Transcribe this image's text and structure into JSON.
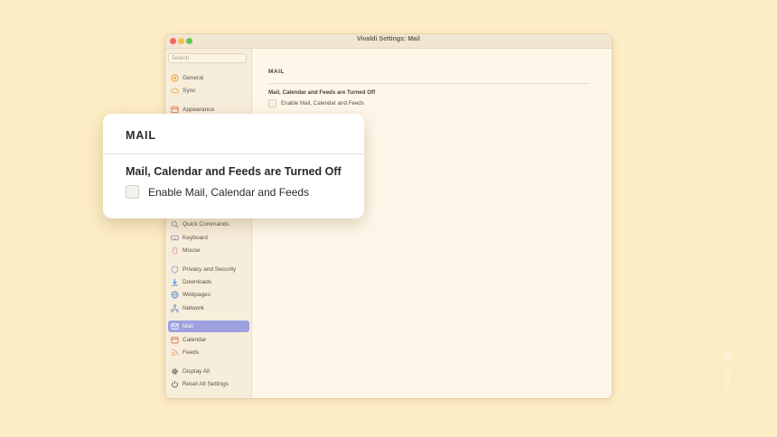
{
  "window": {
    "title": "Vivaldi Settings: Mail"
  },
  "sidebar": {
    "search_placeholder": "Search",
    "items": [
      {
        "label": "General",
        "icon": "general-icon",
        "color": "#f2a33a"
      },
      {
        "label": "Sync",
        "icon": "cloud-icon",
        "color": "#e8b24c"
      },
      {
        "label": "Appearance",
        "icon": "appearance-icon",
        "color": "#e0703a"
      },
      {
        "label": "Quick Commands",
        "icon": "quick-commands-icon",
        "color": "#9a8aa8"
      },
      {
        "label": "Keyboard",
        "icon": "keyboard-icon",
        "color": "#9a8aa8"
      },
      {
        "label": "Mouse",
        "icon": "mouse-icon",
        "color": "#d39ab0"
      },
      {
        "label": "Privacy and Security",
        "icon": "shield-icon",
        "color": "#8a9ad0"
      },
      {
        "label": "Downloads",
        "icon": "download-icon",
        "color": "#4a8ad8"
      },
      {
        "label": "Webpages",
        "icon": "globe-icon",
        "color": "#5a8ad0"
      },
      {
        "label": "Network",
        "icon": "network-icon",
        "color": "#6a8ab0"
      },
      {
        "label": "Mail",
        "icon": "mail-icon",
        "color": "#ffffff",
        "active": true
      },
      {
        "label": "Calendar",
        "icon": "calendar-icon",
        "color": "#e0605a"
      },
      {
        "label": "Feeds",
        "icon": "rss-icon",
        "color": "#e8905a"
      },
      {
        "label": "Display All",
        "icon": "gear-icon",
        "color": "#5b5248"
      },
      {
        "label": "Reset All Settings",
        "icon": "power-icon",
        "color": "#5b5248"
      }
    ]
  },
  "content": {
    "heading": "MAIL",
    "subtitle": "Mail, Calendar and Feeds are Turned Off",
    "checkbox_label": "Enable Mail, Calendar and Feeds",
    "checked": false
  },
  "watermark": {
    "text": "VIVALDI",
    "icon": "vivaldi-logo-icon"
  },
  "colors": {
    "background": "#fdedc6",
    "accent": "#9ea1e0"
  }
}
